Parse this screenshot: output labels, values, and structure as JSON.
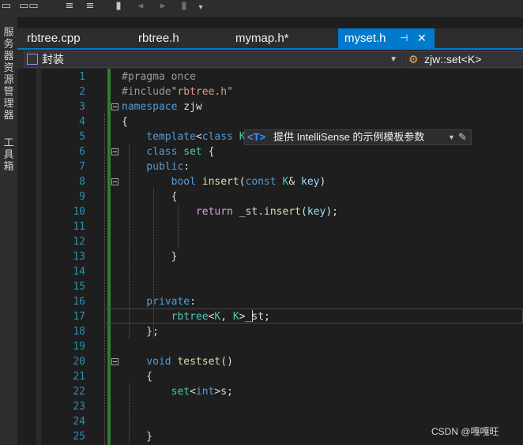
{
  "toolbar": {
    "icons": [
      "save-icon",
      "save-all-icon",
      "comment-icon",
      "uncomment-icon",
      "bookmark-icon",
      "prev-bookmark-icon",
      "next-bookmark-icon",
      "clear-bookmarks-icon",
      "overflow-icon"
    ]
  },
  "sidebar": {
    "server_explorer": "服务器资源管理器",
    "toolbox": "工具箱"
  },
  "tabs": [
    {
      "label": "rbtree.cpp"
    },
    {
      "label": "rbtree.h"
    },
    {
      "label": "mymap.h*"
    },
    {
      "label": "myset.h",
      "pin": "⊣",
      "close": "✕"
    }
  ],
  "navbar": {
    "scope": "封装",
    "member": "zjw::set<K>"
  },
  "code_lines": [
    [
      {
        "t": "#pragma once",
        "c": "#9b9b9b"
      }
    ],
    [
      {
        "t": "#include",
        "c": "#9b9b9b"
      },
      {
        "t": "\"rbtree.h\"",
        "c": "#d69d85"
      }
    ],
    [
      {
        "t": "namespace",
        "c": "#569cd6"
      },
      {
        "t": " zjw",
        "c": "#dcdcdc"
      }
    ],
    [
      {
        "t": "{",
        "c": "#dcdcdc"
      }
    ],
    [
      {
        "t": "    template",
        "c": "#569cd6"
      },
      {
        "t": "<",
        "c": "#dcdcdc"
      },
      {
        "t": "class",
        "c": "#569cd6"
      },
      {
        "t": " ",
        "c": "#dcdcdc"
      },
      {
        "t": "K",
        "c": "#4ec9b0"
      },
      {
        "t": ">",
        "c": "#dcdcdc"
      }
    ],
    [
      {
        "t": "    class",
        "c": "#569cd6"
      },
      {
        "t": " ",
        "c": "#dcdcdc"
      },
      {
        "t": "set",
        "c": "#4ec9b0"
      },
      {
        "t": " {",
        "c": "#dcdcdc"
      }
    ],
    [
      {
        "t": "    public",
        "c": "#569cd6"
      },
      {
        "t": ":",
        "c": "#dcdcdc"
      }
    ],
    [
      {
        "t": "        bool",
        "c": "#569cd6"
      },
      {
        "t": " ",
        "c": "#dcdcdc"
      },
      {
        "t": "insert",
        "c": "#dcdcaa"
      },
      {
        "t": "(",
        "c": "#dcdcdc"
      },
      {
        "t": "const",
        "c": "#569cd6"
      },
      {
        "t": " ",
        "c": "#dcdcdc"
      },
      {
        "t": "K",
        "c": "#4ec9b0"
      },
      {
        "t": "& ",
        "c": "#dcdcdc"
      },
      {
        "t": "key",
        "c": "#9cdcfe"
      },
      {
        "t": ")",
        "c": "#dcdcdc"
      }
    ],
    [
      {
        "t": "        {",
        "c": "#dcdcdc"
      }
    ],
    [
      {
        "t": "            return",
        "c": "#d8a0df"
      },
      {
        "t": " _st.",
        "c": "#dcdcdc"
      },
      {
        "t": "insert",
        "c": "#dcdcaa"
      },
      {
        "t": "(",
        "c": "#dcdcdc"
      },
      {
        "t": "key",
        "c": "#9cdcfe"
      },
      {
        "t": ");",
        "c": "#dcdcdc"
      }
    ],
    [],
    [],
    [
      {
        "t": "        }",
        "c": "#dcdcdc"
      }
    ],
    [],
    [],
    [
      {
        "t": "    private",
        "c": "#569cd6"
      },
      {
        "t": ":",
        "c": "#dcdcdc"
      }
    ],
    [
      {
        "t": "        rbtree",
        "c": "#4ec9b0"
      },
      {
        "t": "<",
        "c": "#dcdcdc"
      },
      {
        "t": "K",
        "c": "#4ec9b0"
      },
      {
        "t": ", ",
        "c": "#dcdcdc"
      },
      {
        "t": "K",
        "c": "#4ec9b0"
      },
      {
        "t": ">_st;",
        "c": "#dcdcdc"
      }
    ],
    [
      {
        "t": "    };",
        "c": "#dcdcdc"
      }
    ],
    [],
    [
      {
        "t": "    void",
        "c": "#569cd6"
      },
      {
        "t": " ",
        "c": "#dcdcdc"
      },
      {
        "t": "testset",
        "c": "#dcdcaa"
      },
      {
        "t": "()",
        "c": "#dcdcdc"
      }
    ],
    [
      {
        "t": "    {",
        "c": "#dcdcdc"
      }
    ],
    [
      {
        "t": "        set",
        "c": "#4ec9b0"
      },
      {
        "t": "<",
        "c": "#dcdcdc"
      },
      {
        "t": "int",
        "c": "#569cd6"
      },
      {
        "t": ">s;",
        "c": "#dcdcdc"
      }
    ],
    [],
    [],
    [
      {
        "t": "    }",
        "c": "#dcdcdc"
      }
    ]
  ],
  "fold_lines": [
    3,
    6,
    8,
    20
  ],
  "intellisense": {
    "tag": "<T>",
    "text": "提供 IntelliSense 的示例模板参数"
  },
  "watermark": "CSDN @嘎嘎旺",
  "colors": {
    "accent": "#007acc",
    "line_number": "#2b91af",
    "keyword": "#569cd6",
    "type": "#4ec9b0",
    "string": "#d69d85",
    "function": "#dcdcaa"
  }
}
